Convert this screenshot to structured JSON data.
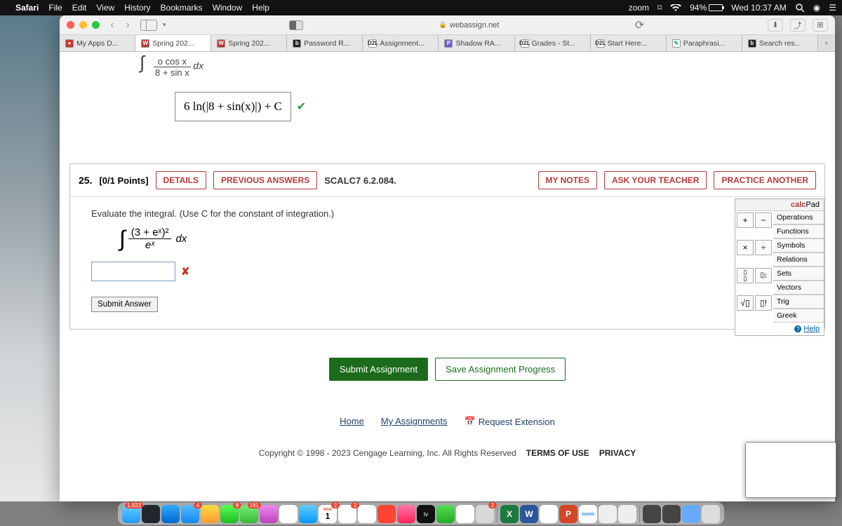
{
  "menubar": {
    "app": "Safari",
    "items": [
      "File",
      "Edit",
      "View",
      "History",
      "Bookmarks",
      "Window",
      "Help"
    ],
    "zoom": "zoom",
    "battery": "94%",
    "clock": "Wed 10:37 AM"
  },
  "safari": {
    "address": "webassign.net",
    "tabs": [
      {
        "label": "My Apps D...",
        "icon_bg": "#c33",
        "icon_fg": "#fff",
        "icon_txt": "●"
      },
      {
        "label": "Spring 202...",
        "icon_bg": "#b33",
        "icon_fg": "#fff",
        "icon_txt": "W",
        "active": true
      },
      {
        "label": "Spring 202...",
        "icon_bg": "#b33",
        "icon_fg": "#fff",
        "icon_txt": "W"
      },
      {
        "label": "Password R...",
        "icon_bg": "#222",
        "icon_fg": "#fff",
        "icon_txt": "b"
      },
      {
        "label": "Assignment...",
        "icon_bg": "#fff",
        "icon_fg": "#333",
        "icon_txt": "D2L"
      },
      {
        "label": "Shadow RA...",
        "icon_bg": "#6a5acd",
        "icon_fg": "#fff",
        "icon_txt": "P"
      },
      {
        "label": "Grades - St...",
        "icon_bg": "#fff",
        "icon_fg": "#333",
        "icon_txt": "D2L"
      },
      {
        "label": "Start Here...",
        "icon_bg": "#fff",
        "icon_fg": "#333",
        "icon_txt": "D2L"
      },
      {
        "label": "Paraphrasi...",
        "icon_bg": "#fff",
        "icon_fg": "#2a8",
        "icon_txt": "✎"
      },
      {
        "label": "Search res...",
        "icon_bg": "#222",
        "icon_fg": "#fff",
        "icon_txt": "b"
      }
    ]
  },
  "page": {
    "prev_integrand_num": "o cos x",
    "prev_integrand_den": "8 + sin x",
    "prev_integrand_dx": "dx",
    "prev_answer": "6 ln(|8 + sin(x)|) + C",
    "q_number": "25.",
    "q_points": "[0/1 Points]",
    "btn_details": "DETAILS",
    "btn_prev": "PREVIOUS ANSWERS",
    "q_ref": "SCALC7 6.2.084.",
    "btn_notes": "MY NOTES",
    "btn_ask": "ASK YOUR TEACHER",
    "btn_practice": "PRACTICE ANOTHER",
    "prompt": "Evaluate the integral. (Use C for the constant of integration.)",
    "int_num": "(3 + eˣ)²",
    "int_den": "eˣ",
    "int_dx": "dx",
    "submit_answer": "Submit Answer",
    "calcpad_title_a": "calc",
    "calcpad_title_b": "Pad",
    "cp_cats": [
      "Operations",
      "Functions",
      "Symbols",
      "Relations",
      "Sets",
      "Vectors",
      "Trig",
      "Greek"
    ],
    "help": "Help",
    "submit_assignment": "Submit Assignment",
    "save_progress": "Save Assignment Progress",
    "link_home": "Home",
    "link_my": "My Assignments",
    "link_ext": "Request Extension",
    "copyright": "Copyright © 1998 - 2023 Cengage Learning, Inc. All Rights Reserved",
    "tou": "TERMS OF USE",
    "privacy": "PRIVACY"
  },
  "dock": {
    "badges": {
      "finder": "1,923",
      "appstore": "4",
      "messages": "8",
      "maps": "161",
      "calendar": "2",
      "reminders": "2",
      "sysprefs": "2"
    },
    "cal_month": "MAR",
    "cal_day": "1",
    "zoom_label": "zoom"
  }
}
